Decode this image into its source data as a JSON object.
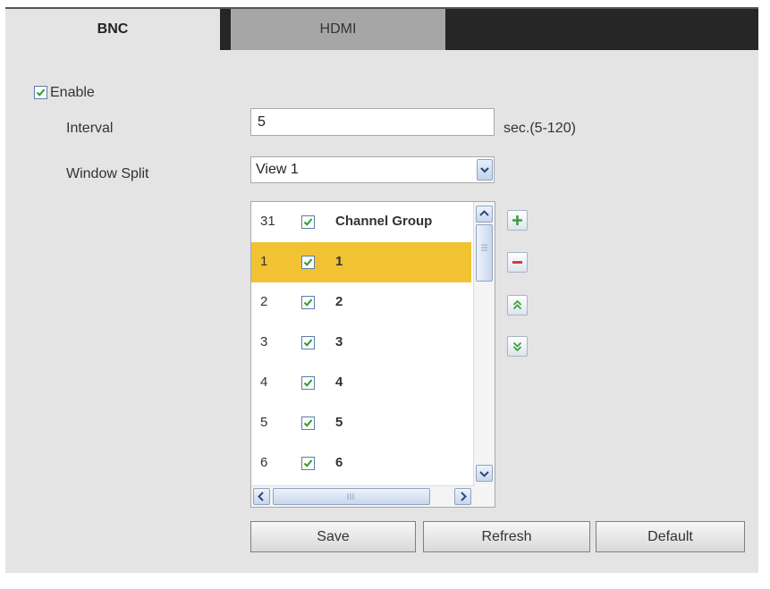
{
  "tabs": {
    "bnc": "BNC",
    "hdmi": "HDMI"
  },
  "enable": {
    "label": "Enable",
    "checked": true
  },
  "interval": {
    "label": "Interval",
    "value": "5",
    "unit": "sec.(5-120)"
  },
  "window_split": {
    "label": "Window Split",
    "value": "View 1"
  },
  "channel_list": {
    "rows": [
      {
        "num": "31",
        "name": "Channel Group",
        "checked": true,
        "selected": false
      },
      {
        "num": "1",
        "name": "1",
        "checked": true,
        "selected": true
      },
      {
        "num": "2",
        "name": "2",
        "checked": true,
        "selected": false
      },
      {
        "num": "3",
        "name": "3",
        "checked": true,
        "selected": false
      },
      {
        "num": "4",
        "name": "4",
        "checked": true,
        "selected": false
      },
      {
        "num": "5",
        "name": "5",
        "checked": true,
        "selected": false
      },
      {
        "num": "6",
        "name": "6",
        "checked": true,
        "selected": false
      }
    ]
  },
  "icons": {
    "add": "plus-icon",
    "remove": "minus-icon",
    "up": "double-chevron-up-icon",
    "down": "double-chevron-down-icon"
  },
  "colors": {
    "selected_row": "#f1c232",
    "add": "#3aa13a",
    "remove": "#d9302c",
    "move": "#3aa13a",
    "tabbar": "#262626"
  },
  "buttons": {
    "save": "Save",
    "refresh": "Refresh",
    "default": "Default"
  }
}
